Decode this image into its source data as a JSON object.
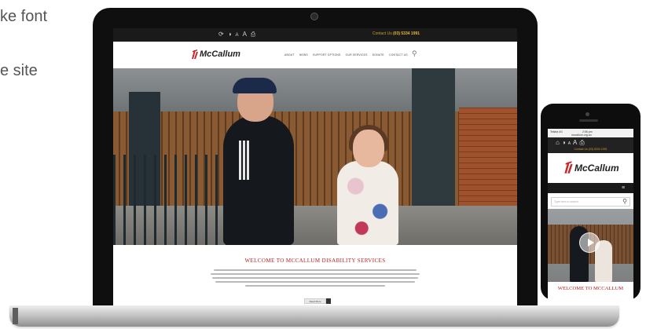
{
  "background_text": {
    "line1": "ke font",
    "line2": "e site"
  },
  "laptop": {
    "topbar": {
      "icons": [
        "refresh-icon",
        "contrast-icon",
        "text-small-icon",
        "text-large-icon",
        "print-icon"
      ],
      "contact_label": "Contact Us",
      "contact_phone": "(03) 5334 1991"
    },
    "nav": {
      "logo": "McCallum",
      "links": [
        "About",
        "News",
        "Support Options",
        "Our Services",
        "Donate",
        "Contact Us"
      ]
    },
    "content": {
      "welcome": "WELCOME TO MCCALLUM DISABILITY SERVICES",
      "more_button": "Read More"
    }
  },
  "phone": {
    "status": {
      "carrier": "Telstra 4G",
      "time": "2:56 pm",
      "url": "mccallum.org.au"
    },
    "contact_label": "Contact Us",
    "contact_phone": "(03) 5334 1991",
    "logo": "McCallum",
    "search_placeholder": "Type here to search",
    "welcome": "WELCOME TO MCCALLUM"
  },
  "colors": {
    "accent_red": "#b71c1c",
    "accent_gold": "#c9a227",
    "dark_bar": "#1a1a1a"
  }
}
